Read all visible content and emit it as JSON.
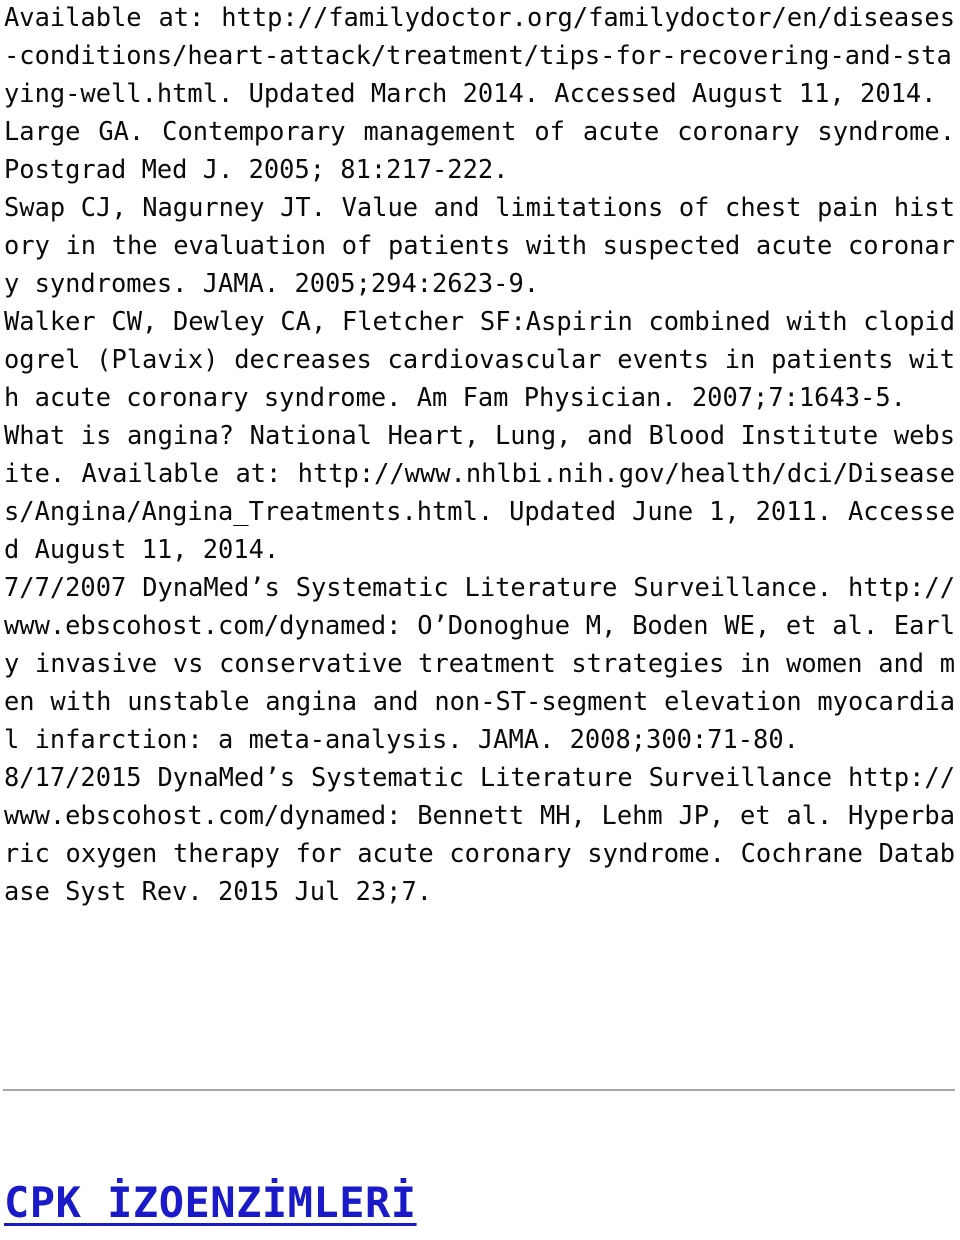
{
  "document": {
    "type": "reference-list",
    "background_color": "#ffffff",
    "body_text_color": "#0a0a0a",
    "divider_color": "#a6a6a6",
    "heading_color": "#1a1ac8"
  },
  "references": [
    {
      "id": "ref-familydoctor",
      "text": "Available at: http://familydoctor.org/familydoctor/en/diseases-conditions/heart-attack/treatment/tips-for-recovering-and-staying-well.html. Updated March 2014. Accessed August 11, 2014."
    },
    {
      "id": "ref-large-ga",
      "text": "Large GA. Contemporary management of acute coronary syndrome. Postgrad Med J. 2005; 81:217-222."
    },
    {
      "id": "ref-swap-nagurney",
      "text": "Swap CJ, Nagurney JT. Value and limitations of chest pain history in the evaluation of patients with suspected acute coronary syndromes. JAMA. 2005;294:2623-9."
    },
    {
      "id": "ref-walker",
      "text": "Walker CW, Dewley CA, Fletcher SF:Aspirin combined with clopidogrel (Plavix) decreases cardiovascular events in patients with acute coronary syndrome. Am Fam Physician. 2007;7:1643-5."
    },
    {
      "id": "ref-nhlbi-angina",
      "text": "What is angina? National Heart, Lung, and Blood Institute website. Available at: http://www.nhlbi.nih.gov/health/dci/Diseases/Angina/Angina_Treatments.html. Updated June 1, 2011. Accessed August 11, 2014."
    },
    {
      "id": "ref-dynamed-2007",
      "text": "7/7/2007 DynaMed’s Systematic Literature Surveillance. http://www.ebscohost.com/dynamed: O’Donoghue M, Boden WE, et al. Early invasive vs conservative treatment strategies in women and men with unstable angina and non-ST-segment elevation myocardial infarction: a meta-analysis. JAMA. 2008;300:71-80."
    },
    {
      "id": "ref-dynamed-2015",
      "text": "8/17/2015 DynaMed’s Systematic Literature Surveillance http://www.ebscohost.com/dynamed: Bennett MH, Lehm JP, et al. Hyperbaric oxygen therapy for acute coronary syndrome. Cochrane Database Syst Rev. 2015 Jul 23;7."
    }
  ],
  "section": {
    "heading": "CPK İZOENZİMLERİ"
  }
}
